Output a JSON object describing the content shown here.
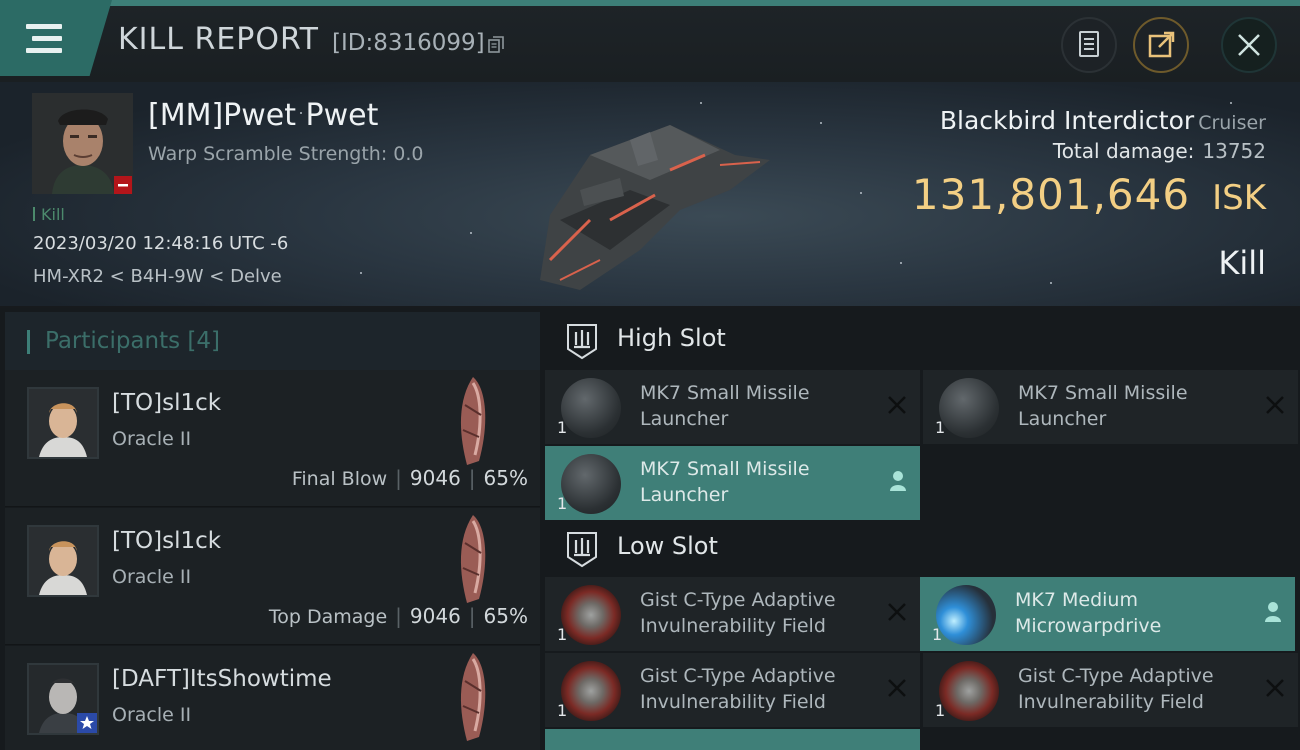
{
  "header": {
    "title": "KILL REPORT",
    "report_id": "[ID:8316099]",
    "icons": [
      "menu-icon",
      "copy-icon",
      "notes-icon",
      "share-icon",
      "close-icon"
    ],
    "accent_color": "#3d7f78"
  },
  "victim": {
    "name": "[MM]Pwet Pwet",
    "warp_scramble": "Warp Scramble Strength: 0.0",
    "kill_tag": "Kill",
    "datetime": "2023/03/20 12:48:16 UTC -6",
    "location": "HM-XR2 < B4H-9W < Delve"
  },
  "ship": {
    "name": "Blackbird Interdictor",
    "class": "Cruiser",
    "total_damage_label": "Total damage:",
    "total_damage_value": "13752",
    "isk_value": "131,801,646",
    "isk_unit": "ISK",
    "result": "Kill",
    "isk_color": "#f3cf84"
  },
  "participants": {
    "label": "Participants",
    "count": "[4]",
    "rows": [
      {
        "name": "[TO]sl1ck",
        "ship": "Oracle II",
        "role": "Final Blow",
        "damage": "9046",
        "percent": "65%"
      },
      {
        "name": "[TO]sl1ck",
        "ship": "Oracle II",
        "role": "Top Damage",
        "damage": "9046",
        "percent": "65%"
      },
      {
        "name": "[DAFT]ItsShowtime",
        "ship": "Oracle II"
      }
    ]
  },
  "slots": {
    "high": {
      "title": "High Slot",
      "modules": [
        {
          "name": "MK7 Small Missile Launcher",
          "qty": "1",
          "status": "destroyed"
        },
        {
          "name": "MK7 Small Missile Launcher",
          "qty": "1",
          "status": "destroyed"
        },
        {
          "name": "MK7 Small Missile Launcher",
          "qty": "1",
          "status": "dropped"
        }
      ]
    },
    "low": {
      "title": "Low Slot",
      "modules": [
        {
          "name": "Gist C-Type Adaptive Invulnerability Field",
          "qty": "1",
          "status": "destroyed"
        },
        {
          "name": "MK7 Medium Microwarpdrive",
          "qty": "1",
          "status": "dropped"
        },
        {
          "name": "Gist C-Type Adaptive Invulnerability Field",
          "qty": "1",
          "status": "destroyed"
        },
        {
          "name": "Gist C-Type Adaptive Invulnerability Field",
          "qty": "1",
          "status": "destroyed"
        }
      ]
    }
  }
}
